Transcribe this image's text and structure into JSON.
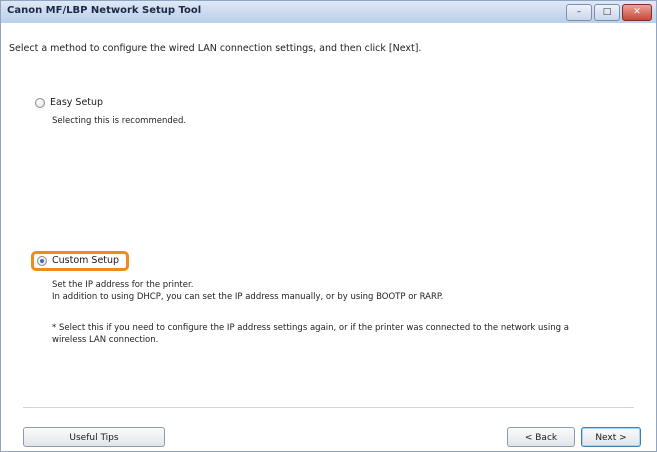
{
  "window": {
    "title": "Canon MF/LBP Network Setup Tool",
    "controls": {
      "minimize": "–",
      "maximize": "□",
      "close": "✕"
    }
  },
  "instruction": "Select a method to configure the wired LAN connection settings, and then click [Next].",
  "options": [
    {
      "label": "Easy Setup",
      "selected": false,
      "description": [
        "Selecting this is recommended."
      ]
    },
    {
      "label": "Custom Setup",
      "selected": true,
      "highlighted": true,
      "description": [
        "Set the IP address for the printer.",
        "In addition to using DHCP, you can set the IP address manually, or by using BOOTP or RARP."
      ],
      "note": [
        "* Select this if you need to configure the IP address settings again, or if the printer was connected to the network using a",
        "wireless LAN connection."
      ]
    }
  ],
  "buttons": {
    "useful_tips": "Useful Tips",
    "back": "< Back",
    "next": "Next >"
  },
  "colors": {
    "highlight": "#f08a1c",
    "titlebar": "#c8d8ee",
    "selected_radio": "#3b6fc2"
  }
}
